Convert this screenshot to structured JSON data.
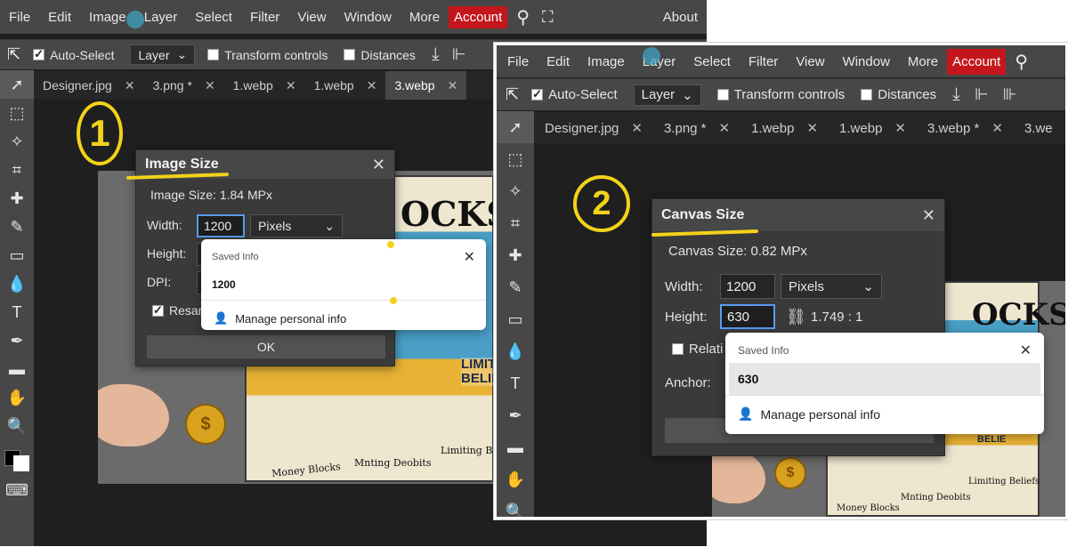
{
  "menu": {
    "items": [
      "File",
      "Edit",
      "Image",
      "Layer",
      "Select",
      "Filter",
      "View",
      "Window",
      "More"
    ],
    "account": "Account",
    "about": "About"
  },
  "options": {
    "auto_select": "Auto-Select",
    "layer_select": "Layer",
    "transform": "Transform controls",
    "distances": "Distances"
  },
  "tabs1": [
    {
      "label": "Designer.jpg"
    },
    {
      "label": "3.png *"
    },
    {
      "label": "1.webp"
    },
    {
      "label": "1.webp"
    },
    {
      "label": "3.webp"
    }
  ],
  "tabs2": [
    {
      "label": "Designer.jpg"
    },
    {
      "label": "3.png *"
    },
    {
      "label": "1.webp"
    },
    {
      "label": "1.webp"
    },
    {
      "label": "3.webp *"
    },
    {
      "label": "3.we"
    }
  ],
  "annotations": {
    "step1": "1",
    "step2": "2"
  },
  "image_size": {
    "title": "Image Size",
    "info": "Image Size: 1.84 MPx",
    "width_label": "Width:",
    "width_value": "1200",
    "unit": "Pixels",
    "height_label": "Height:",
    "dpi_label": "DPI:",
    "resample_label": "Resan",
    "ok": "OK"
  },
  "popup1": {
    "title": "Saved Info",
    "value": "1200",
    "manage": "Manage personal info"
  },
  "canvas_size": {
    "title": "Canvas Size",
    "info": "Canvas Size: 0.82 MPx",
    "width_label": "Width:",
    "width_value": "1200",
    "unit": "Pixels",
    "height_label": "Height:",
    "height_value": "630",
    "ratio": "1.749 : 1",
    "relative_label": "Relati",
    "anchor_label": "Anchor:"
  },
  "popup2": {
    "title": "Saved Info",
    "value": "630",
    "manage": "Manage personal info"
  },
  "artwork": {
    "headline": "OCKS",
    "sub1": "LIMITI",
    "sub2": "BELIE",
    "caption1": "Money Blocks",
    "caption2": "Mnting Deobits",
    "caption3": "Limiting Beliefs",
    "coin": "$"
  }
}
